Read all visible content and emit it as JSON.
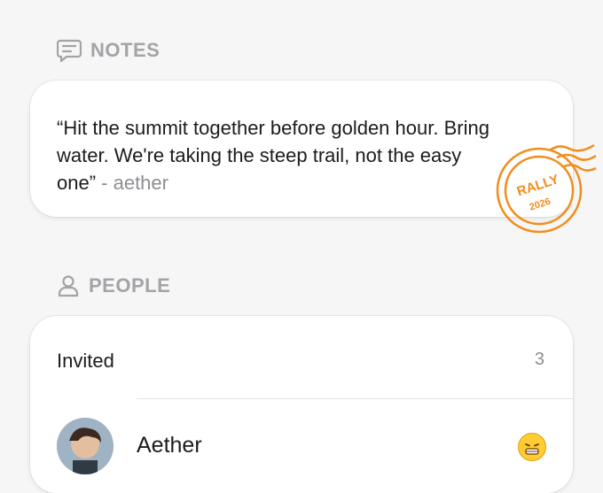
{
  "notes": {
    "section_title": "NOTES",
    "quote": "“Hit the summit together before golden hour. Bring water. We're taking the steep trail, not the easy one”",
    "author": " - aether"
  },
  "stamp": {
    "line1": "RALLY",
    "line2": "2026",
    "color": "#f28c1c"
  },
  "people": {
    "section_title": "PEOPLE",
    "invited_label": "Invited",
    "invited_count": "3",
    "members": [
      {
        "name": "Aether",
        "status_icon": "grimacing-emoji-icon"
      }
    ]
  }
}
